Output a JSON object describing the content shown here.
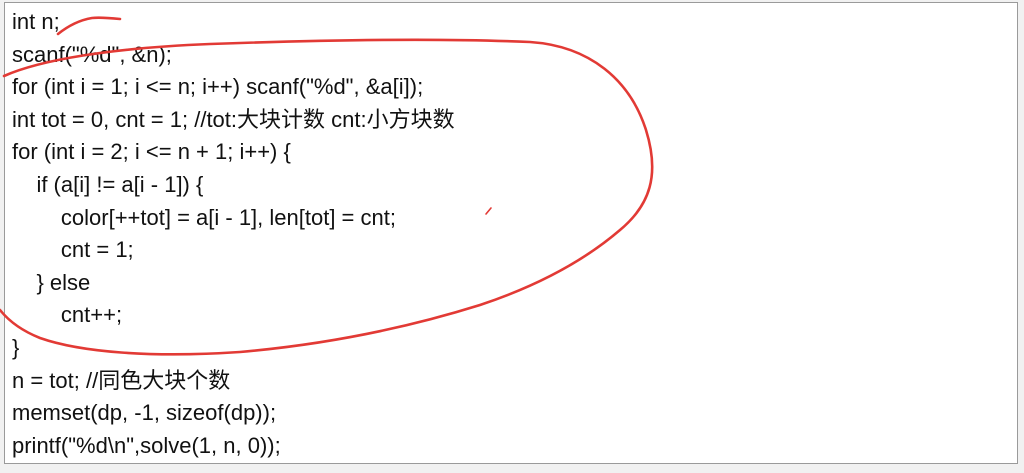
{
  "code": {
    "lines": [
      "int n;",
      "scanf(\"%d\", &n);",
      "for (int i = 1; i <= n; i++) scanf(\"%d\", &a[i]);",
      "int tot = 0, cnt = 1; //tot:大块计数 cnt:小方块数",
      "for (int i = 2; i <= n + 1; i++) {",
      "    if (a[i] != a[i - 1]) {",
      "        color[++tot] = a[i - 1], len[tot] = cnt;",
      "        cnt = 1;",
      "    } else",
      "        cnt++;",
      "}",
      "n = tot; //同色大块个数",
      "memset(dp, -1, sizeof(dp));",
      "printf(\"%d\\n\",solve(1, n, 0));"
    ]
  },
  "annotation": {
    "stroke_color": "#e23a35"
  }
}
